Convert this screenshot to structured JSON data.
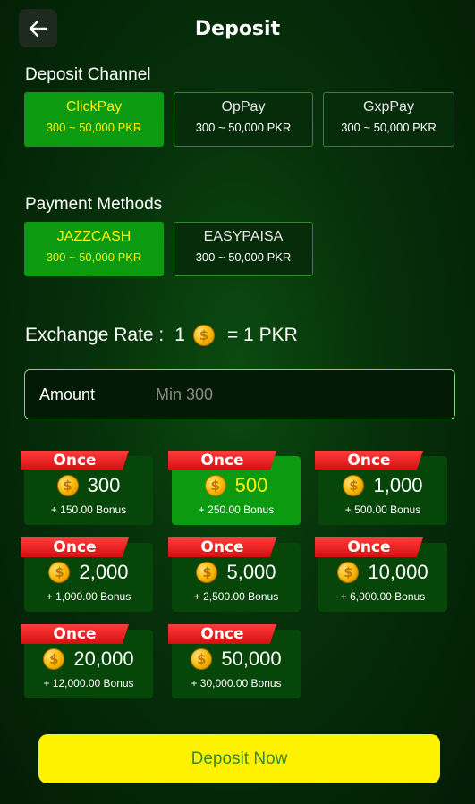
{
  "header": {
    "title": "Deposit"
  },
  "deposit_channel": {
    "title": "Deposit Channel",
    "items": [
      {
        "name": "ClickPay",
        "range": "300 ~ 50,000 PKR",
        "active": true
      },
      {
        "name": "OpPay",
        "range": "300 ~ 50,000 PKR",
        "active": false
      },
      {
        "name": "GxpPay",
        "range": "300 ~ 50,000 PKR",
        "active": false
      }
    ]
  },
  "payment_methods": {
    "title": "Payment Methods",
    "items": [
      {
        "name": "JAZZCASH",
        "range": "300 ~ 50,000 PKR",
        "active": true
      },
      {
        "name": "EASYPAISA",
        "range": "300 ~ 50,000 PKR",
        "active": false
      }
    ]
  },
  "exchange_rate": {
    "label": "Exchange Rate :",
    "left": "1",
    "right": "= 1 PKR"
  },
  "amount": {
    "label": "Amount",
    "placeholder": "Min 300",
    "value": ""
  },
  "packages": [
    {
      "badge": "Once",
      "amount": "300",
      "bonus": "+ 150.00 Bonus",
      "active": false
    },
    {
      "badge": "Once",
      "amount": "500",
      "bonus": "+ 250.00 Bonus",
      "active": true
    },
    {
      "badge": "Once",
      "amount": "1,000",
      "bonus": "+ 500.00 Bonus",
      "active": false
    },
    {
      "badge": "Once",
      "amount": "2,000",
      "bonus": "+ 1,000.00 Bonus",
      "active": false
    },
    {
      "badge": "Once",
      "amount": "5,000",
      "bonus": "+ 2,500.00 Bonus",
      "active": false
    },
    {
      "badge": "Once",
      "amount": "10,000",
      "bonus": "+ 6,000.00 Bonus",
      "active": false
    },
    {
      "badge": "Once",
      "amount": "20,000",
      "bonus": "+ 12,000.00 Bonus",
      "active": false
    },
    {
      "badge": "Once",
      "amount": "50,000",
      "bonus": "+ 30,000.00 Bonus",
      "active": false
    }
  ],
  "deposit_button": "Deposit Now",
  "colors": {
    "active_green": "#0b9a10",
    "highlight_yellow": "#ffef00",
    "button_yellow": "#fff200",
    "ribbon_red": "#e81e1e"
  },
  "icons": {
    "back": "arrow-left-icon",
    "coin": "coin-icon"
  }
}
